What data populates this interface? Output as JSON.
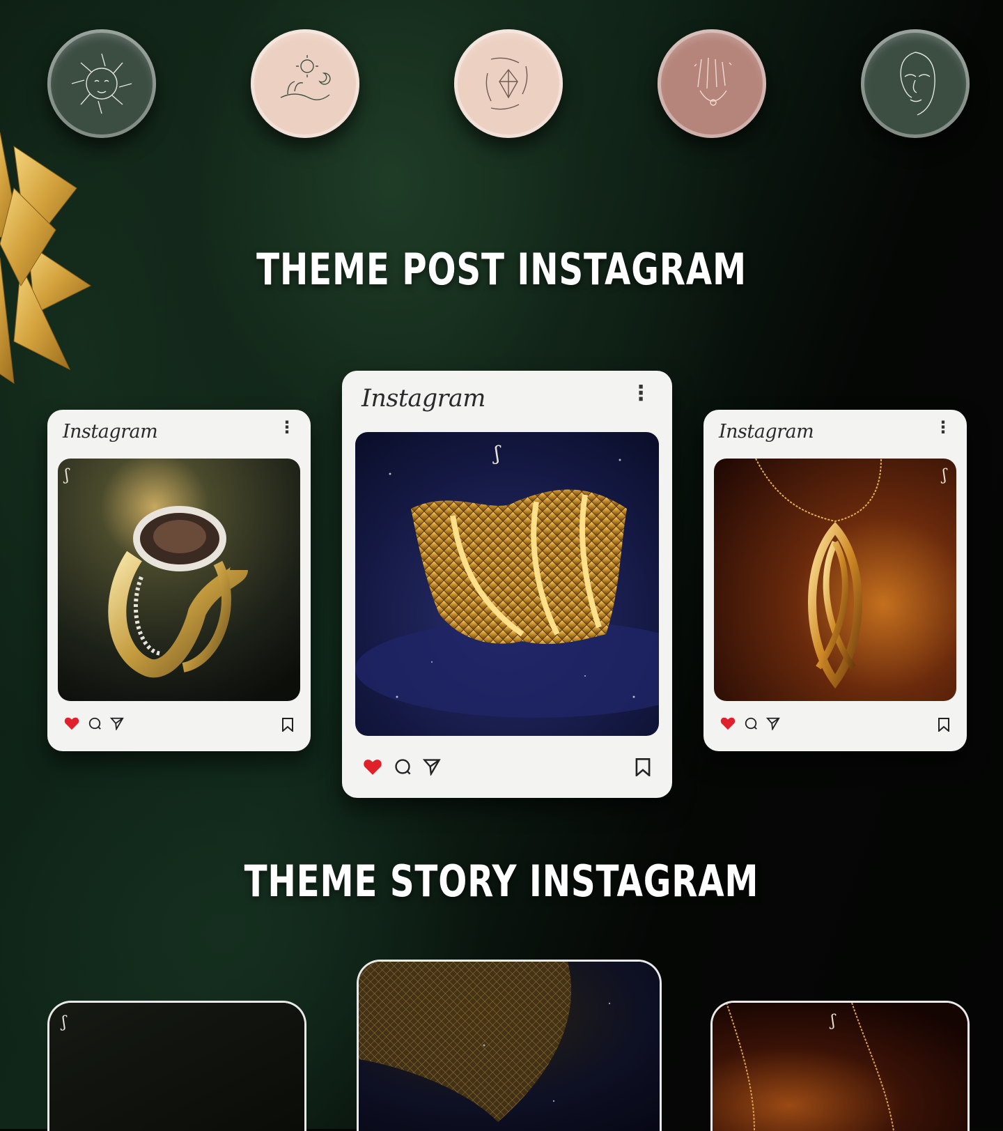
{
  "headings": {
    "post": "THEME POST INSTAGRAM",
    "story": "THEME STORY INSTAGRAM"
  },
  "highlights": [
    {
      "icon": "sun-face-icon",
      "color": "#3c4d42"
    },
    {
      "icon": "hand-sun-moon-icon",
      "color": "#ecd0c1"
    },
    {
      "icon": "hands-crystal-icon",
      "color": "#ecd0c1"
    },
    {
      "icon": "hands-jewelry-icon",
      "color": "#b5847a"
    },
    {
      "icon": "line-face-icon",
      "color": "#3c4d42"
    }
  ],
  "posts": [
    {
      "logo": "Instagram",
      "menu": "⋮",
      "image": "ring-photo"
    },
    {
      "logo": "Instagram",
      "menu": "⋮",
      "image": "bracelet-photo"
    },
    {
      "logo": "Instagram",
      "menu": "⋮",
      "image": "pendant-photo"
    }
  ],
  "colors": {
    "heart": "#e0202a",
    "card": "#f3f3f2",
    "gold": "#d9a93f"
  }
}
